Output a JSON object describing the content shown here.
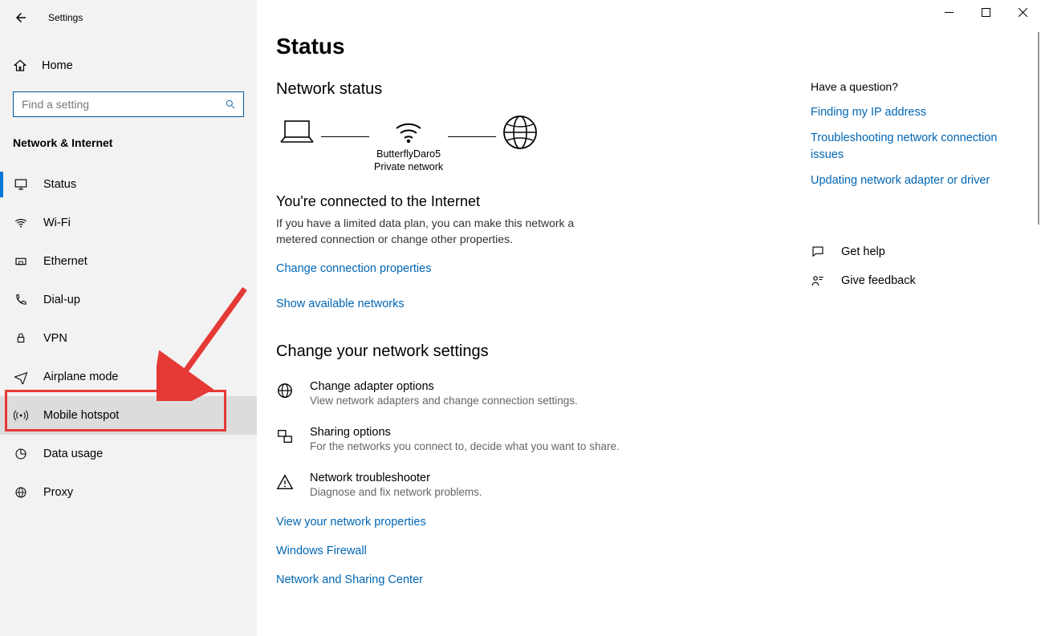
{
  "window": {
    "title": "Settings"
  },
  "sidebar": {
    "home_label": "Home",
    "search_placeholder": "Find a setting",
    "category_heading": "Network & Internet",
    "items": [
      {
        "label": "Status"
      },
      {
        "label": "Wi-Fi"
      },
      {
        "label": "Ethernet"
      },
      {
        "label": "Dial-up"
      },
      {
        "label": "VPN"
      },
      {
        "label": "Airplane mode"
      },
      {
        "label": "Mobile hotspot"
      },
      {
        "label": "Data usage"
      },
      {
        "label": "Proxy"
      }
    ]
  },
  "main": {
    "page_title": "Status",
    "network_status_heading": "Network status",
    "network_name": "ButterflyDaro5",
    "network_type": "Private network",
    "connected_heading": "You're connected to the Internet",
    "connected_body": "If you have a limited data plan, you can make this network a metered connection or change other properties.",
    "link_change_conn": "Change connection properties",
    "link_show_networks": "Show available networks",
    "change_settings_heading": "Change your network settings",
    "options": [
      {
        "title": "Change adapter options",
        "desc": "View network adapters and change connection settings."
      },
      {
        "title": "Sharing options",
        "desc": "For the networks you connect to, decide what you want to share."
      },
      {
        "title": "Network troubleshooter",
        "desc": "Diagnose and fix network problems."
      }
    ],
    "link_view_props": "View your network properties",
    "link_firewall": "Windows Firewall",
    "link_sharing_center": "Network and Sharing Center"
  },
  "aside": {
    "question_heading": "Have a question?",
    "links": [
      "Finding my IP address",
      "Troubleshooting network connection issues",
      "Updating network adapter or driver"
    ],
    "get_help": "Get help",
    "give_feedback": "Give feedback"
  }
}
